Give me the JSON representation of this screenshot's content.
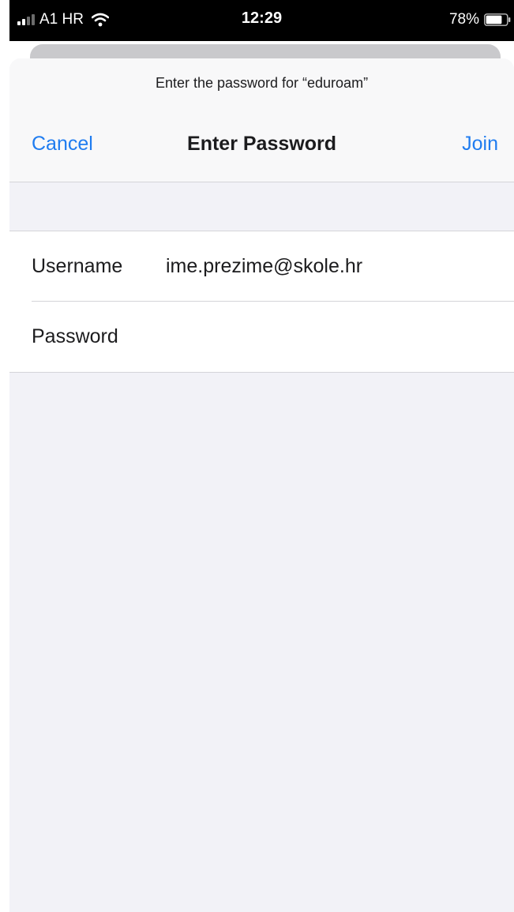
{
  "status_bar": {
    "carrier": "A1 HR",
    "time": "12:29",
    "battery": "78%",
    "signal_bars_active": 2,
    "signal_bars_total": 4,
    "battery_level": 0.78,
    "icons": [
      "signal-icon",
      "wifi-icon",
      "battery-icon"
    ]
  },
  "dialog": {
    "prompt": "Enter the password for “eduroam”",
    "title": "Enter Password",
    "cancel_label": "Cancel",
    "join_label": "Join",
    "accent_color": "#1f7cf0"
  },
  "form": {
    "username_label": "Username",
    "username_value": "ime.prezime@skole.hr",
    "password_label": "Password",
    "password_value": ""
  }
}
